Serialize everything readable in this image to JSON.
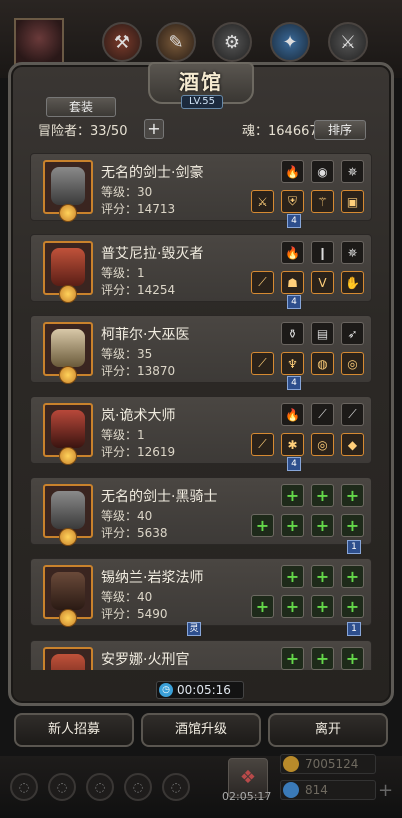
{
  "header": {
    "title": "酒馆",
    "level": "LV.55",
    "set_label": "套装",
    "adventurer_count": "冒险者：33/50",
    "add_label": "+",
    "soul": "魂：164667",
    "sort_label": "排序"
  },
  "heroes": [
    {
      "name": "无名的剑士·剑豪",
      "level": "等级：30",
      "score": "评分：14713",
      "connector": "4"
    },
    {
      "name": "普艾尼拉·毁灭者",
      "level": "等级：1",
      "score": "评分：14254",
      "connector": "4"
    },
    {
      "name": "柯菲尔·大巫医",
      "level": "等级：35",
      "score": "评分：13870",
      "connector": "4"
    },
    {
      "name": "岚·诡术大师",
      "level": "等级：1",
      "score": "评分：12619",
      "connector": "4"
    },
    {
      "name": "无名的剑士·黑骑士",
      "level": "等级：40",
      "score": "评分：5638",
      "connector": "1"
    },
    {
      "name": "锡纳兰·岩浆法师",
      "level": "等级：40",
      "score": "评分：5490",
      "connector": "1",
      "connector_left": "灵"
    },
    {
      "name": "安罗娜·火刑官",
      "level": "",
      "score": "",
      "connector": ""
    }
  ],
  "timer": "00:05:16",
  "buttons": {
    "recruit": "新人招募",
    "upgrade": "酒馆升级",
    "leave": "离开"
  },
  "bottom": {
    "gift_timer": "02:05:17",
    "gold": "7005124",
    "gems": "814",
    "plus": "+"
  },
  "colors": {
    "accent": "#c9822c",
    "empty_slot": "#64d84a",
    "connector": "#2e4f8d"
  }
}
